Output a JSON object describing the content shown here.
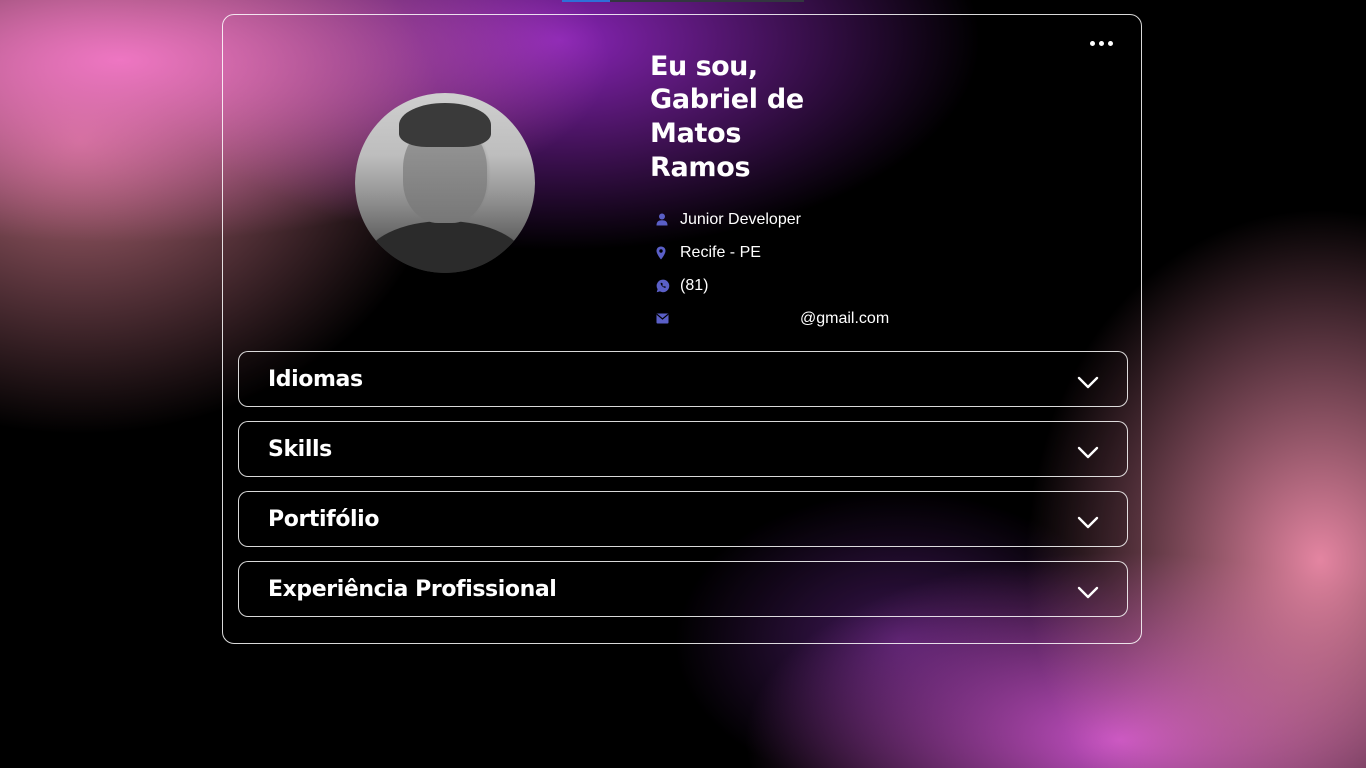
{
  "page": {
    "accent_color": "#5a5fc7",
    "background_color": "#000000"
  },
  "menu": {
    "icon": "ellipsis-horizontal-icon"
  },
  "profile": {
    "avatar": "profile-photo",
    "greeting": "Eu sou,",
    "name": "Gabriel de Matos Ramos",
    "details": [
      {
        "icon": "user-icon",
        "text": "Junior Developer"
      },
      {
        "icon": "map-pin-icon",
        "text": "Recife - PE"
      },
      {
        "icon": "whatsapp-icon",
        "text": "(81)"
      },
      {
        "icon": "envelope-icon",
        "text": "@gmail.com"
      }
    ]
  },
  "sections": [
    {
      "title": "Idiomas",
      "icon": "chevron-down-icon"
    },
    {
      "title": "Skills",
      "icon": "chevron-down-icon"
    },
    {
      "title": "Portifólio",
      "icon": "chevron-down-icon"
    },
    {
      "title": "Experiência Profissional",
      "icon": "chevron-down-icon"
    }
  ]
}
